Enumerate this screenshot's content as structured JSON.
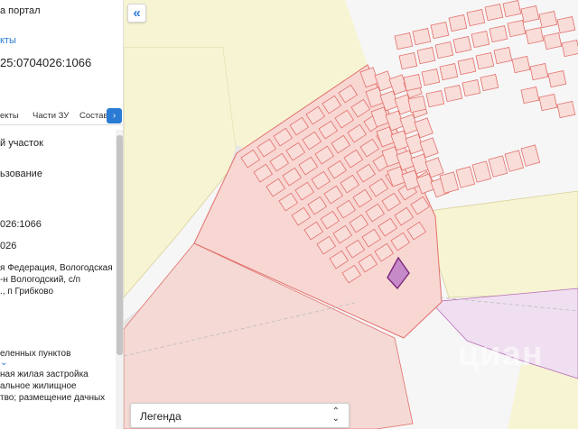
{
  "panel": {
    "portal_title": "а портал",
    "section_link": "кты",
    "cadastral_number": "25:0704026:1066",
    "tabs": [
      "екты",
      "Части ЗУ",
      "Состав"
    ],
    "next_tab_icon": "›",
    "info_lines": [
      "й участок",
      "ьзование",
      "026:1066",
      "026",
      "я Федерация, Вологодская",
      "-н Вологодский, с/п",
      "., п Грибково",
      "еленных пунктов",
      "ная жилая застройка",
      "альное жилищное",
      "тво; размещение дачных"
    ],
    "expand_icon": "⌄"
  },
  "map": {
    "collapse_icon": "«",
    "legend_label": "Легенда",
    "legend_icon": "chevron-up-down-icon",
    "watermark": "циан",
    "colors": {
      "parcel_fill": "#f8d7d3",
      "parcel_stroke": "#e2706b",
      "yellow_zone": "#f7f4d3",
      "pink_zone": "#f4d9d5",
      "purple_zone": "#efdff0",
      "selected_parcel": "#9b3f9b"
    }
  }
}
